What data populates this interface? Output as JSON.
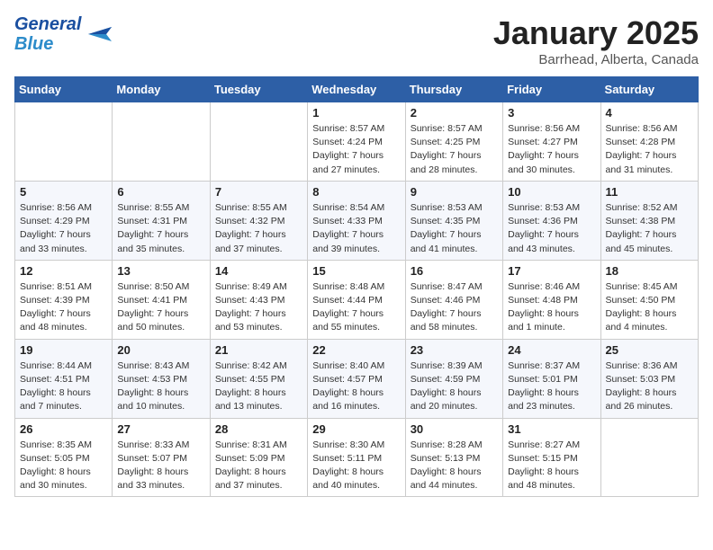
{
  "header": {
    "logo_general": "General",
    "logo_blue": "Blue",
    "month_title": "January 2025",
    "location": "Barrhead, Alberta, Canada"
  },
  "days_of_week": [
    "Sunday",
    "Monday",
    "Tuesday",
    "Wednesday",
    "Thursday",
    "Friday",
    "Saturday"
  ],
  "weeks": [
    [
      {
        "day": "",
        "info": ""
      },
      {
        "day": "",
        "info": ""
      },
      {
        "day": "",
        "info": ""
      },
      {
        "day": "1",
        "info": "Sunrise: 8:57 AM\nSunset: 4:24 PM\nDaylight: 7 hours\nand 27 minutes."
      },
      {
        "day": "2",
        "info": "Sunrise: 8:57 AM\nSunset: 4:25 PM\nDaylight: 7 hours\nand 28 minutes."
      },
      {
        "day": "3",
        "info": "Sunrise: 8:56 AM\nSunset: 4:27 PM\nDaylight: 7 hours\nand 30 minutes."
      },
      {
        "day": "4",
        "info": "Sunrise: 8:56 AM\nSunset: 4:28 PM\nDaylight: 7 hours\nand 31 minutes."
      }
    ],
    [
      {
        "day": "5",
        "info": "Sunrise: 8:56 AM\nSunset: 4:29 PM\nDaylight: 7 hours\nand 33 minutes."
      },
      {
        "day": "6",
        "info": "Sunrise: 8:55 AM\nSunset: 4:31 PM\nDaylight: 7 hours\nand 35 minutes."
      },
      {
        "day": "7",
        "info": "Sunrise: 8:55 AM\nSunset: 4:32 PM\nDaylight: 7 hours\nand 37 minutes."
      },
      {
        "day": "8",
        "info": "Sunrise: 8:54 AM\nSunset: 4:33 PM\nDaylight: 7 hours\nand 39 minutes."
      },
      {
        "day": "9",
        "info": "Sunrise: 8:53 AM\nSunset: 4:35 PM\nDaylight: 7 hours\nand 41 minutes."
      },
      {
        "day": "10",
        "info": "Sunrise: 8:53 AM\nSunset: 4:36 PM\nDaylight: 7 hours\nand 43 minutes."
      },
      {
        "day": "11",
        "info": "Sunrise: 8:52 AM\nSunset: 4:38 PM\nDaylight: 7 hours\nand 45 minutes."
      }
    ],
    [
      {
        "day": "12",
        "info": "Sunrise: 8:51 AM\nSunset: 4:39 PM\nDaylight: 7 hours\nand 48 minutes."
      },
      {
        "day": "13",
        "info": "Sunrise: 8:50 AM\nSunset: 4:41 PM\nDaylight: 7 hours\nand 50 minutes."
      },
      {
        "day": "14",
        "info": "Sunrise: 8:49 AM\nSunset: 4:43 PM\nDaylight: 7 hours\nand 53 minutes."
      },
      {
        "day": "15",
        "info": "Sunrise: 8:48 AM\nSunset: 4:44 PM\nDaylight: 7 hours\nand 55 minutes."
      },
      {
        "day": "16",
        "info": "Sunrise: 8:47 AM\nSunset: 4:46 PM\nDaylight: 7 hours\nand 58 minutes."
      },
      {
        "day": "17",
        "info": "Sunrise: 8:46 AM\nSunset: 4:48 PM\nDaylight: 8 hours\nand 1 minute."
      },
      {
        "day": "18",
        "info": "Sunrise: 8:45 AM\nSunset: 4:50 PM\nDaylight: 8 hours\nand 4 minutes."
      }
    ],
    [
      {
        "day": "19",
        "info": "Sunrise: 8:44 AM\nSunset: 4:51 PM\nDaylight: 8 hours\nand 7 minutes."
      },
      {
        "day": "20",
        "info": "Sunrise: 8:43 AM\nSunset: 4:53 PM\nDaylight: 8 hours\nand 10 minutes."
      },
      {
        "day": "21",
        "info": "Sunrise: 8:42 AM\nSunset: 4:55 PM\nDaylight: 8 hours\nand 13 minutes."
      },
      {
        "day": "22",
        "info": "Sunrise: 8:40 AM\nSunset: 4:57 PM\nDaylight: 8 hours\nand 16 minutes."
      },
      {
        "day": "23",
        "info": "Sunrise: 8:39 AM\nSunset: 4:59 PM\nDaylight: 8 hours\nand 20 minutes."
      },
      {
        "day": "24",
        "info": "Sunrise: 8:37 AM\nSunset: 5:01 PM\nDaylight: 8 hours\nand 23 minutes."
      },
      {
        "day": "25",
        "info": "Sunrise: 8:36 AM\nSunset: 5:03 PM\nDaylight: 8 hours\nand 26 minutes."
      }
    ],
    [
      {
        "day": "26",
        "info": "Sunrise: 8:35 AM\nSunset: 5:05 PM\nDaylight: 8 hours\nand 30 minutes."
      },
      {
        "day": "27",
        "info": "Sunrise: 8:33 AM\nSunset: 5:07 PM\nDaylight: 8 hours\nand 33 minutes."
      },
      {
        "day": "28",
        "info": "Sunrise: 8:31 AM\nSunset: 5:09 PM\nDaylight: 8 hours\nand 37 minutes."
      },
      {
        "day": "29",
        "info": "Sunrise: 8:30 AM\nSunset: 5:11 PM\nDaylight: 8 hours\nand 40 minutes."
      },
      {
        "day": "30",
        "info": "Sunrise: 8:28 AM\nSunset: 5:13 PM\nDaylight: 8 hours\nand 44 minutes."
      },
      {
        "day": "31",
        "info": "Sunrise: 8:27 AM\nSunset: 5:15 PM\nDaylight: 8 hours\nand 48 minutes."
      },
      {
        "day": "",
        "info": ""
      }
    ]
  ]
}
